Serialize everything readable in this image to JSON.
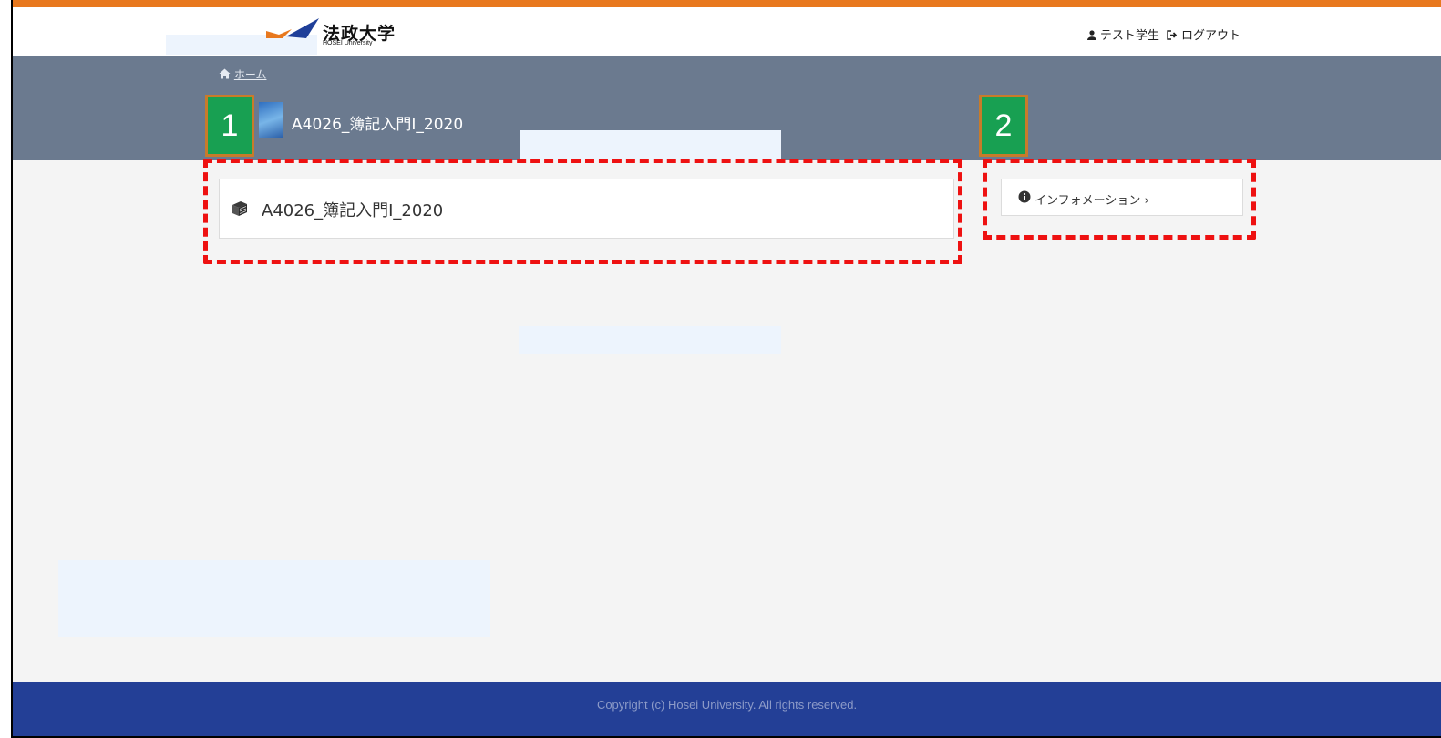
{
  "header": {
    "logo_kanji": "法政大学",
    "logo_english": "HOSEI University",
    "user_name": "テスト学生",
    "logout_label": "ログアウト"
  },
  "breadcrumb": {
    "home_label": "ホーム"
  },
  "course": {
    "title": "A4026_簿記入門Ⅰ_2020",
    "card_label": "A4026_簿記入門Ⅰ_2020"
  },
  "information": {
    "label": "インフォメーション ›"
  },
  "annotations": {
    "badge_1": "1",
    "badge_2": "2"
  },
  "footer": {
    "copyright": "Copyright (c) Hosei University. All rights reserved."
  },
  "colors": {
    "accent_orange": "#e8781e",
    "header_band": "#6b7a8f",
    "footer": "#233f96",
    "annotation_red": "#ee1111",
    "badge_green": "#18a052"
  },
  "icons": [
    "user-icon",
    "sign-out-icon",
    "home-icon",
    "book-icon",
    "info-circle-icon"
  ]
}
